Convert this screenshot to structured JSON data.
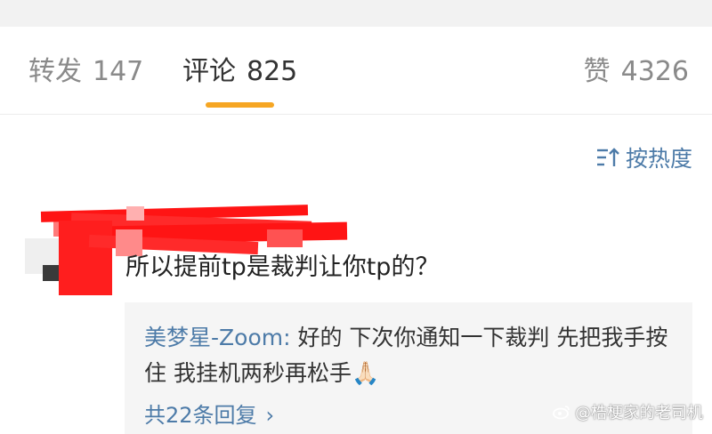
{
  "tabs": {
    "repost": {
      "label": "转发",
      "count": "147"
    },
    "comment": {
      "label": "评论",
      "count": "825"
    },
    "like": {
      "label": "赞",
      "count": "4326"
    }
  },
  "sort": {
    "label": "按热度"
  },
  "comment": {
    "text": "所以提前tp是裁判让你tp的？",
    "username_redacted": true
  },
  "reply": {
    "author": "美梦星-Zoom:",
    "text": " 好的 下次你通知一下裁判 先把我手按住 我挂机两秒再松手🙏🏻",
    "more": "共22条回复"
  },
  "watermark": {
    "text": "@梏梗家的老司机"
  },
  "colors": {
    "accent_underline": "#f6a623",
    "link_blue": "#4d7ba8",
    "censor_red": "#ff1414"
  }
}
